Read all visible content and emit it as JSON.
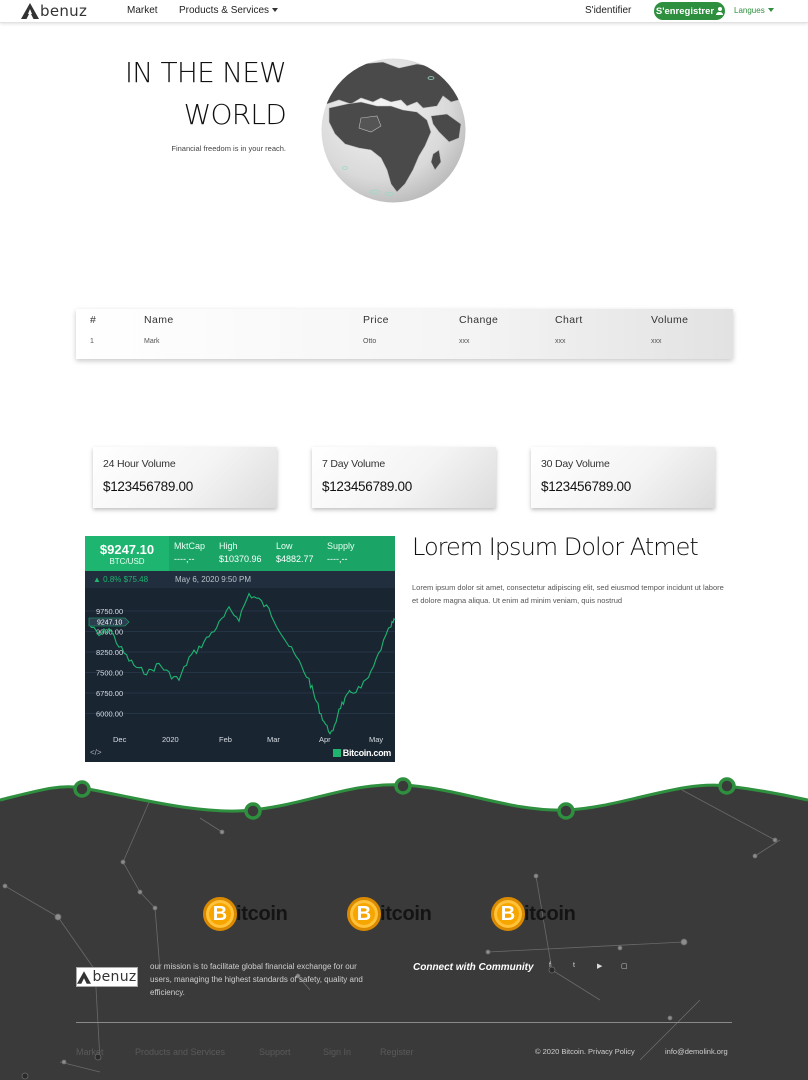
{
  "nav": {
    "logo_text": "benuz",
    "market": "Market",
    "products": "Products & Services",
    "signin": "S'identifier",
    "register": "S'enregistrer",
    "languages": "Langues"
  },
  "hero": {
    "title_line1": "IN THE NEW",
    "title_line2": "WORLD",
    "subtitle": "Financial freedom is in your reach."
  },
  "table": {
    "headers": [
      "#",
      "Name",
      "Price",
      "Change",
      "Chart",
      "Volume"
    ],
    "rows": [
      [
        "1",
        "Mark",
        "Otto",
        "xxx",
        "xxx",
        "xxx"
      ]
    ]
  },
  "stats": [
    {
      "label": "24 Hour Volume",
      "value": "$123456789.00"
    },
    {
      "label": "7 Day Volume",
      "value": "$123456789.00"
    },
    {
      "label": "30 Day Volume",
      "value": "$123456789.00"
    }
  ],
  "widget": {
    "price": "$9247.10",
    "pair": "BTC/USD",
    "mktcap_label": "MktCap",
    "mktcap_value": "----,--",
    "high_label": "High",
    "high_value": "$10370.96",
    "low_label": "Low",
    "low_value": "$4882.77",
    "supply_label": "Supply",
    "supply_value": "----,--",
    "change": "0.8%  $75.48",
    "date": "May 6, 2020 9:50 PM",
    "embed": "</>",
    "brand": "Bitcoin.com",
    "current_tag": "9247.10",
    "y_ticks": [
      "9750.00",
      "9000.00",
      "8250.00",
      "7500.00",
      "6750.00",
      "6000.00"
    ],
    "x_ticks": [
      "Dec",
      "2020",
      "Feb",
      "Mar",
      "Apr",
      "May"
    ],
    "accent_color": "#1db56f"
  },
  "lorem": {
    "title": "Lorem Ipsum Dolor Atmet",
    "body": "Lorem ipsum dolor sit amet, consectetur adipiscing elit, sed eiusmod tempor incidunt ut labore et dolore magna aliqua. Ut enim ad minim veniam, quis nostrud"
  },
  "footer": {
    "coin_text": "itcoin",
    "coin_letter": "B",
    "logo_text": "benuz",
    "mission": "our mission is to facilitate global financial exchange for our users, managing the highest standards of safety, quality and efficiency.",
    "connect": "Connect with Community",
    "social": [
      "f",
      "t",
      "▶",
      "▢"
    ],
    "links": [
      "Market",
      "Products and Services",
      "Support",
      "Sign In",
      "Register"
    ],
    "copyright": "© 2020 Bitcoin. Privacy Policy",
    "email": "info@demolink.org",
    "wave_color": "#2e8f3e",
    "bg_color": "#3a3a3a"
  }
}
